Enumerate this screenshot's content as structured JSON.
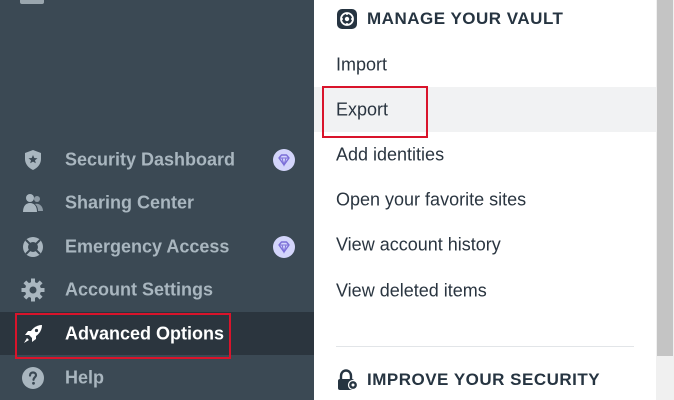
{
  "sidebar": {
    "items": [
      {
        "label": "Security Dashboard",
        "icon": "shield-star-icon",
        "premium": true
      },
      {
        "label": "Sharing Center",
        "icon": "people-icon",
        "premium": false
      },
      {
        "label": "Emergency Access",
        "icon": "lifebuoy-icon",
        "premium": true
      },
      {
        "label": "Account Settings",
        "icon": "gear-icon",
        "premium": false
      },
      {
        "label": "Advanced Options",
        "icon": "rocket-icon",
        "premium": false,
        "active": true
      },
      {
        "label": "Help",
        "icon": "help-icon",
        "premium": false
      }
    ]
  },
  "main": {
    "vault_title": "MANAGE YOUR VAULT",
    "vault_items": [
      {
        "label": "Import"
      },
      {
        "label": "Export"
      },
      {
        "label": "Add identities"
      },
      {
        "label": "Open your favorite sites"
      },
      {
        "label": "View account history"
      },
      {
        "label": "View deleted items"
      }
    ],
    "security_title": "IMPROVE YOUR SECURITY"
  },
  "colors": {
    "sidebar_bg": "#3b4954",
    "sidebar_active_bg": "#2b353e",
    "highlight_red": "#d9142b",
    "premium_badge": "#d3d5fb"
  }
}
